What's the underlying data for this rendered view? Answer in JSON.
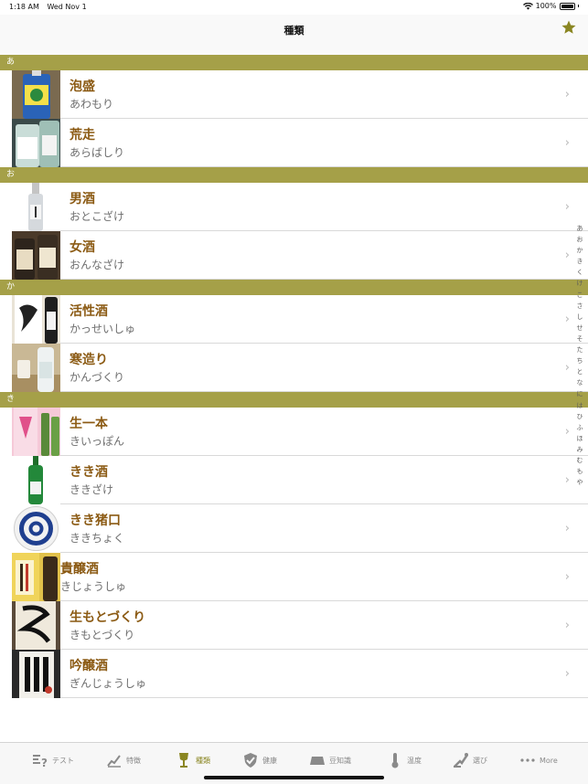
{
  "status": {
    "time": "1:18 AM",
    "date": "Wed Nov 1",
    "battery": "100%"
  },
  "nav": {
    "title": "種類",
    "favorite_icon": "star-icon"
  },
  "colors": {
    "accent": "#a5a048",
    "title_text": "#8b5a13",
    "subtitle_text": "#6e6e6e",
    "active_tab": "#8a8622"
  },
  "sections": [
    {
      "header": "あ",
      "rows": [
        {
          "title": "泡盛",
          "subtitle": "あわもり"
        },
        {
          "title": "荒走",
          "subtitle": "あらばしり"
        }
      ]
    },
    {
      "header": "お",
      "rows": [
        {
          "title": "男酒",
          "subtitle": "おとこざけ"
        },
        {
          "title": "女酒",
          "subtitle": "おんなざけ"
        }
      ]
    },
    {
      "header": "か",
      "rows": [
        {
          "title": "活性酒",
          "subtitle": "かっせいしゅ"
        },
        {
          "title": "寒造り",
          "subtitle": "かんづくり"
        }
      ]
    },
    {
      "header": "き",
      "rows": [
        {
          "title": "生一本",
          "subtitle": "きいっぽん"
        },
        {
          "title": "きき酒",
          "subtitle": "ききざけ"
        },
        {
          "title": "きき猪口",
          "subtitle": "ききちょく"
        },
        {
          "title": "貴醸酒",
          "subtitle": "きじょうしゅ"
        },
        {
          "title": "生もとづくり",
          "subtitle": "きもとづくり"
        },
        {
          "title": "吟醸酒",
          "subtitle": "ぎんじょうしゅ"
        }
      ]
    }
  ],
  "index": [
    "あ",
    "お",
    "か",
    "き",
    "く",
    "け",
    "こ",
    "さ",
    "し",
    "せ",
    "そ",
    "た",
    "ち",
    "と",
    "な",
    "に",
    "は",
    "ひ",
    "ふ",
    "ほ",
    "み",
    "む",
    "も",
    "や"
  ],
  "tabs": [
    {
      "label": "テスト",
      "icon": "quiz-icon"
    },
    {
      "label": "特徴",
      "icon": "chart-icon"
    },
    {
      "label": "種類",
      "icon": "glass-icon",
      "active": true
    },
    {
      "label": "健康",
      "icon": "shield-check-icon"
    },
    {
      "label": "豆知識",
      "icon": "bean-icon"
    },
    {
      "label": "温度",
      "icon": "thermometer-icon"
    },
    {
      "label": "選び",
      "icon": "hand-pick-icon"
    },
    {
      "label": "More",
      "icon": "more-icon"
    }
  ]
}
